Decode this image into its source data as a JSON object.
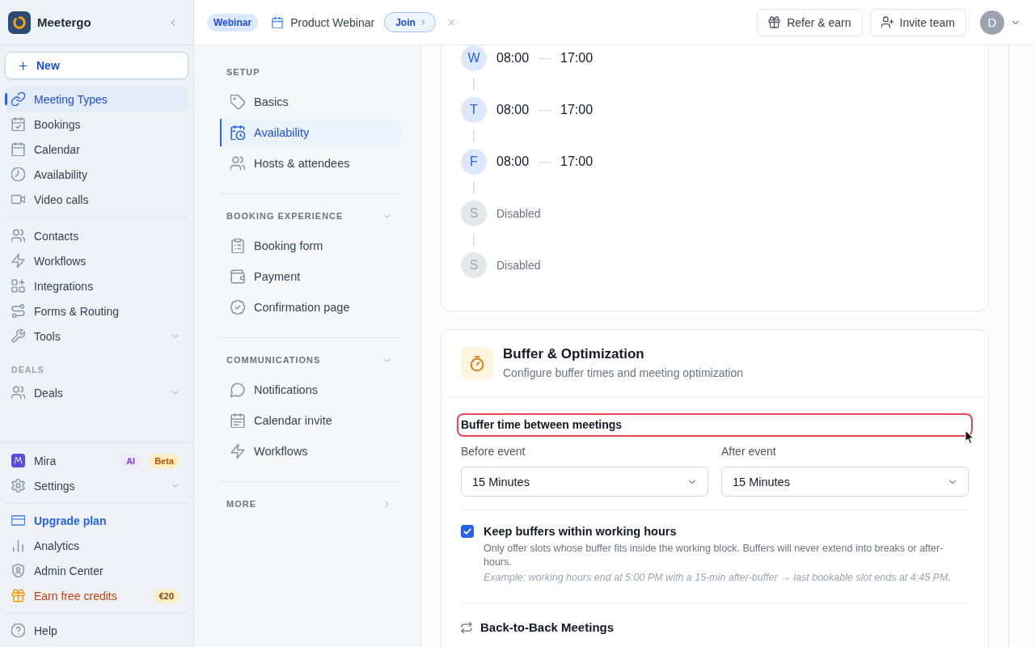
{
  "sidebar": {
    "brand": "Meetergo",
    "new_button": "New",
    "sections": [
      {
        "items": [
          {
            "label": "Meeting Types",
            "kind": "link",
            "selected": true
          },
          {
            "label": "Bookings",
            "kind": "link",
            "selected": false
          },
          {
            "label": "Calendar",
            "kind": "link",
            "selected": false
          },
          {
            "label": "Availability",
            "kind": "link",
            "selected": false
          },
          {
            "label": "Video calls",
            "kind": "link",
            "selected": false
          }
        ]
      },
      {
        "items": [
          {
            "label": "Contacts",
            "kind": "link",
            "selected": false
          },
          {
            "label": "Workflows",
            "kind": "link",
            "selected": false
          },
          {
            "label": "Integrations",
            "kind": "link",
            "selected": false
          },
          {
            "label": "Forms & Routing",
            "kind": "link",
            "selected": false
          },
          {
            "label": "Tools",
            "kind": "menu",
            "selected": false
          }
        ]
      },
      {
        "heading": "DEALS",
        "items": [
          {
            "label": "Deals",
            "kind": "menu",
            "selected": false
          }
        ]
      }
    ],
    "footer_sections": [
      {
        "items": [
          {
            "label": "Mira",
            "kind": "link",
            "selected": false,
            "badges": [
              {
                "label": "AI",
                "kind": "ai"
              },
              {
                "label": "Beta",
                "kind": "beta"
              }
            ]
          },
          {
            "label": "Settings",
            "kind": "menu",
            "selected": false
          }
        ]
      },
      {
        "items": [
          {
            "label": "Upgrade plan",
            "kind": "upgrade",
            "selected": false
          },
          {
            "label": "Analytics",
            "kind": "link",
            "selected": false
          },
          {
            "label": "Admin Center",
            "kind": "link",
            "selected": false
          },
          {
            "label": "Earn free credits",
            "kind": "promo",
            "selected": false,
            "badges": [
              {
                "label": "€20",
                "kind": "credit"
              }
            ]
          }
        ]
      },
      {
        "items": [
          {
            "label": "Help",
            "kind": "link",
            "selected": false
          }
        ]
      }
    ]
  },
  "top_bar": {
    "event_type": "Webinar",
    "event_title": "Product Webinar",
    "join_button": "Join",
    "actions": [
      {
        "label": "Refer & earn"
      },
      {
        "label": "Invite team"
      }
    ],
    "avatar": "D"
  },
  "settings_nav": {
    "sections": [
      {
        "heading": "SETUP",
        "collapsible": false,
        "expanded": true,
        "items": [
          {
            "label": "Basics",
            "selected": false
          },
          {
            "label": "Availability",
            "selected": true
          },
          {
            "label": "Hosts & attendees",
            "selected": false
          }
        ]
      },
      {
        "heading": "BOOKING EXPERIENCE",
        "collapsible": true,
        "expanded": true,
        "items": [
          {
            "label": "Booking form",
            "selected": false
          },
          {
            "label": "Payment",
            "selected": false
          },
          {
            "label": "Confirmation page",
            "selected": false
          }
        ]
      },
      {
        "heading": "COMMUNICATIONS",
        "collapsible": true,
        "expanded": true,
        "items": [
          {
            "label": "Notifications",
            "selected": false
          },
          {
            "label": "Calendar invite",
            "selected": false
          },
          {
            "label": "Workflows",
            "selected": false
          }
        ]
      },
      {
        "heading": "MORE",
        "collapsible": true,
        "expanded": false
      }
    ]
  },
  "schedule_card": {
    "days": [
      {
        "letter": "W",
        "enabled": true,
        "start": "08:00",
        "end": "17:00"
      },
      {
        "letter": "T",
        "enabled": true,
        "start": "08:00",
        "end": "17:00"
      },
      {
        "letter": "F",
        "enabled": true,
        "start": "08:00",
        "end": "17:00"
      },
      {
        "letter": "S",
        "enabled": false,
        "status": "Disabled"
      },
      {
        "letter": "S",
        "enabled": false,
        "status": "Disabled"
      }
    ]
  },
  "buffer_card": {
    "title": "Buffer & Optimization",
    "subtitle": "Configure buffer times and meeting optimization",
    "buffer_time": {
      "label": "Buffer time between meetings",
      "highlighted": true,
      "fields": [
        {
          "label": "Before event",
          "value": "15 Minutes"
        },
        {
          "label": "After event",
          "value": "15 Minutes"
        }
      ]
    },
    "keep_within_hours": {
      "label": "Keep buffers within working hours",
      "checked": true,
      "description": "Only offer slots whose buffer fits inside the working block. Buffers will never extend into breaks or after-hours.",
      "example": "Example: working hours end at 5:00 PM with a 15-min after-buffer → last bookable slot ends at 4:45 PM."
    },
    "back_to_back": {
      "title": "Back-to-Back Meetings"
    }
  }
}
